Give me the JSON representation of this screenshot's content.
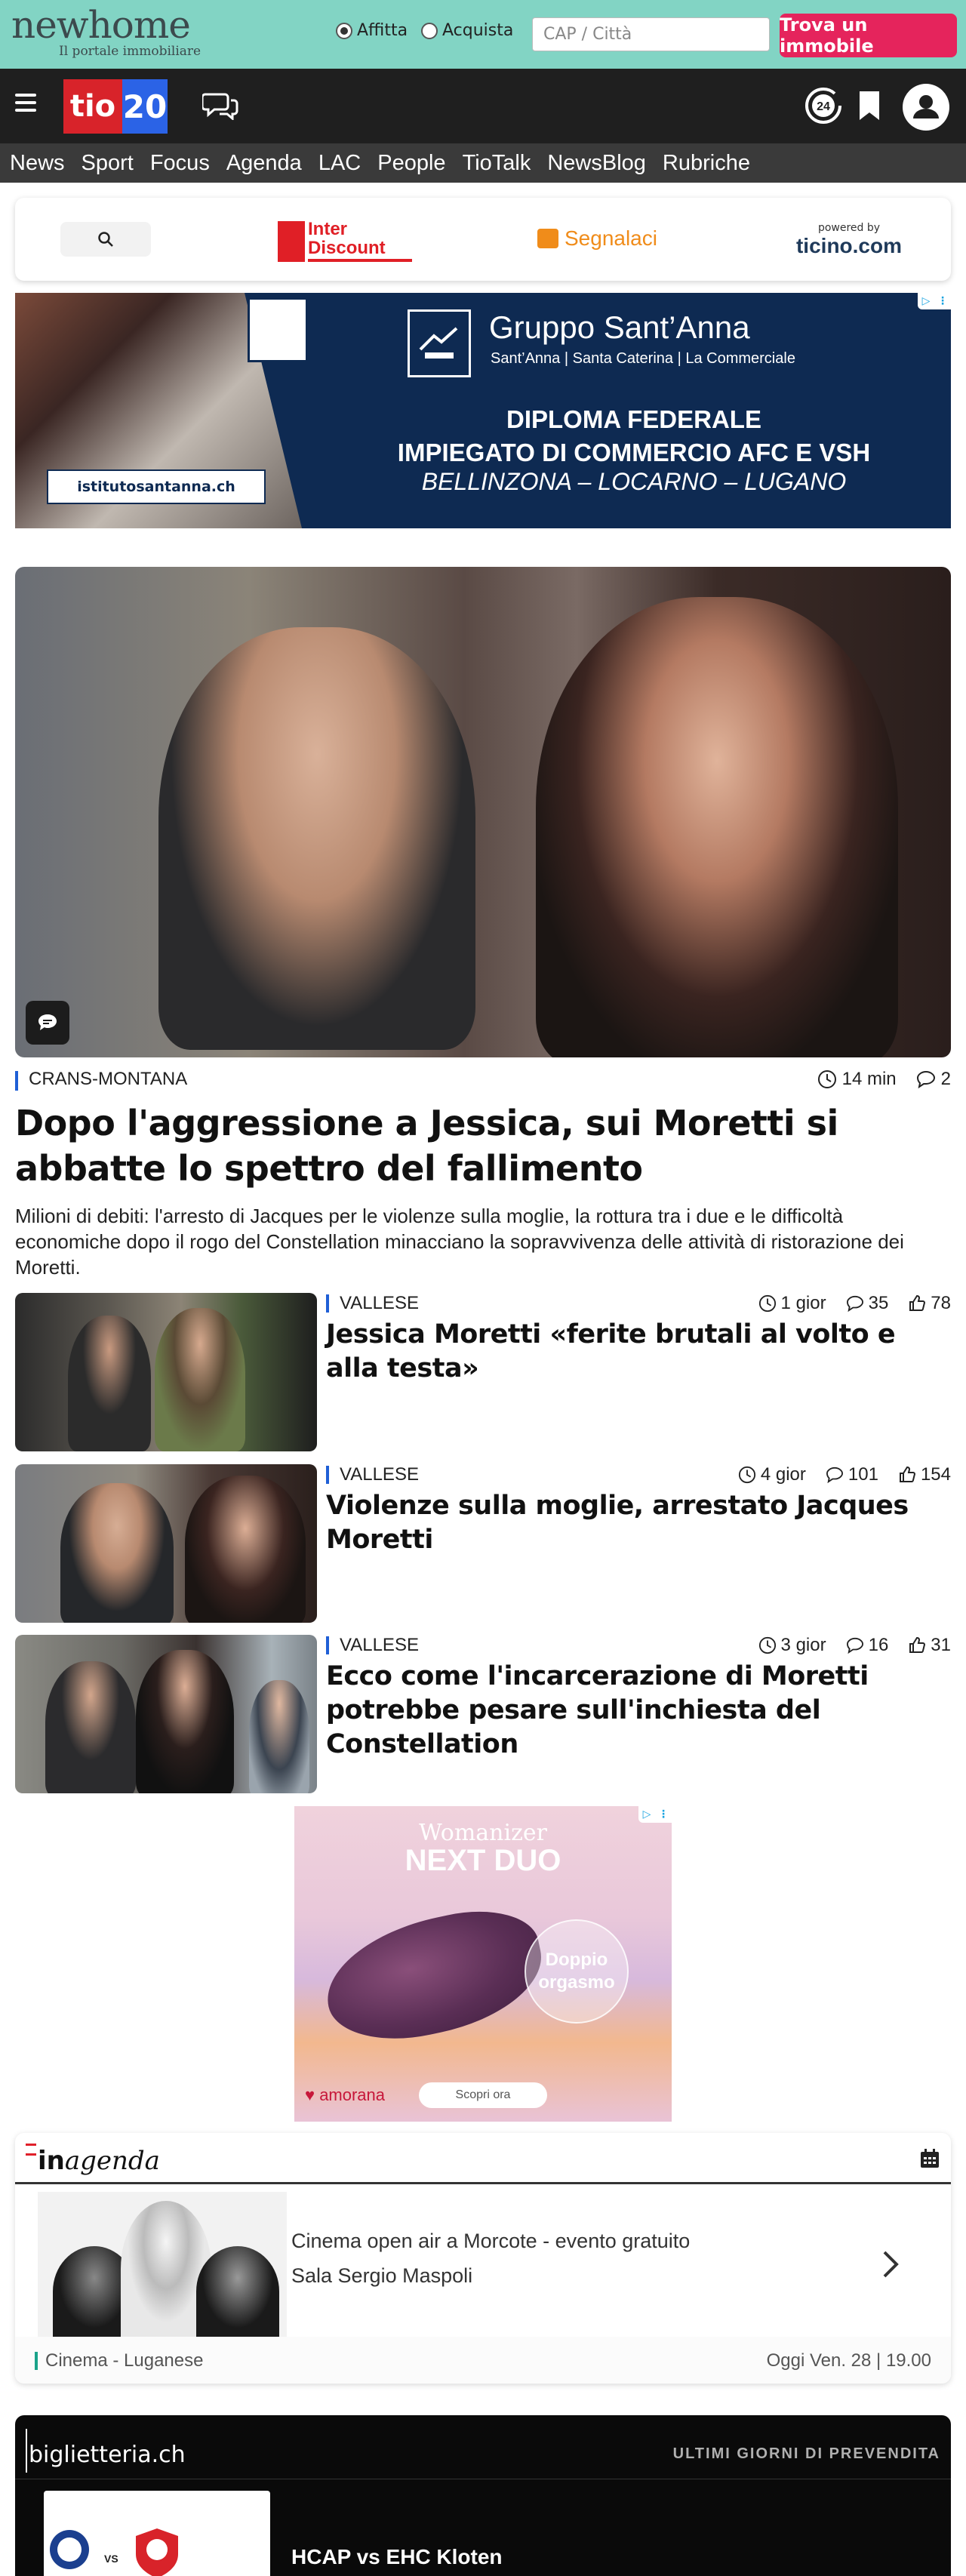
{
  "newhome": {
    "logo": "newhome",
    "tagline": "Il portale immobiliare",
    "radio_rent": "Affitta",
    "radio_buy": "Acquista",
    "search_placeholder": "CAP / Città",
    "cta": "Trova un immobile",
    "bg_color": "#82d4c4",
    "cta_color": "#e5245c"
  },
  "header": {
    "logo_left": "tio",
    "logo_right": "20",
    "icons": [
      "menu-icon",
      "chat-bubbles-icon",
      "news-24-icon",
      "bookmark-icon",
      "user-avatar-icon"
    ]
  },
  "nav": {
    "items": [
      "News",
      "Sport",
      "Focus",
      "Agenda",
      "LAC",
      "People",
      "TioTalk",
      "NewsBlog",
      "Rubriche"
    ]
  },
  "utility": {
    "search_icon": "search-icon",
    "sponsor": "Inter Discount",
    "sponsor_line1": "Inter",
    "sponsor_line2": "Discount",
    "report": "Segnalaci",
    "powered_label": "powered by",
    "powered_brand": "ticino.com"
  },
  "ad_banner": {
    "brand": "Gruppo Sant’Anna",
    "sub": "Sant’Anna | Santa Caterina | La Commerciale",
    "headline_1": "DIPLOMA FEDERALE",
    "headline_2": "IMPIEGATO DI COMMERCIO AFC E VSH",
    "locations": "BELLINZONA – LOCARNO – LUGANO",
    "url": "istitutosantanna.ch"
  },
  "hero": {
    "kicker": "CRANS-MONTANA",
    "time": "14 min",
    "comments": "2",
    "title": "Dopo l'aggressione a Jessica, sui Moretti si abbatte lo spettro del fallimento",
    "lead": "Milioni di debiti: l'arresto di Jacques per le violenze sulla moglie, la rottura tra i due e le difficoltà economiche dopo il rogo del Constellation minacciano la sopravvivenza delle attività di ristorazione dei Moretti."
  },
  "related": [
    {
      "kicker": "VALLESE",
      "time": "1 gior",
      "comments": "35",
      "likes": "78",
      "title": "Jessica Moretti «ferite brutali al volto e alla testa»"
    },
    {
      "kicker": "VALLESE",
      "time": "4 gior",
      "comments": "101",
      "likes": "154",
      "title": "Violenze sulla moglie, arrestato Jacques Moretti"
    },
    {
      "kicker": "VALLESE",
      "time": "3 gior",
      "comments": "16",
      "likes": "31",
      "title": "Ecco come l'incarcerazione di Moretti potrebbe pesare sull'inchiesta del Constellation"
    }
  ],
  "ad_square": {
    "brand": "Womanizer",
    "product": "NEXT DUO",
    "badge": "Doppio orgasmo",
    "shop": "amorana",
    "cta": "Scopri ora"
  },
  "agenda": {
    "logo_in": "in",
    "logo_word": "agenda",
    "event_title": "Cinema open air a Morcote - evento gratuito",
    "venue": "Sala Sergio Maspoli",
    "category": "Cinema - Luganese",
    "date": "Oggi Ven. 28 | 19.00"
  },
  "biglietteria": {
    "logo": "biglietteria.ch",
    "badge": "ULTIMI GIORNI DI PREVENDITA",
    "vs": "VS",
    "match": "HCAP vs EHC Kloten"
  }
}
